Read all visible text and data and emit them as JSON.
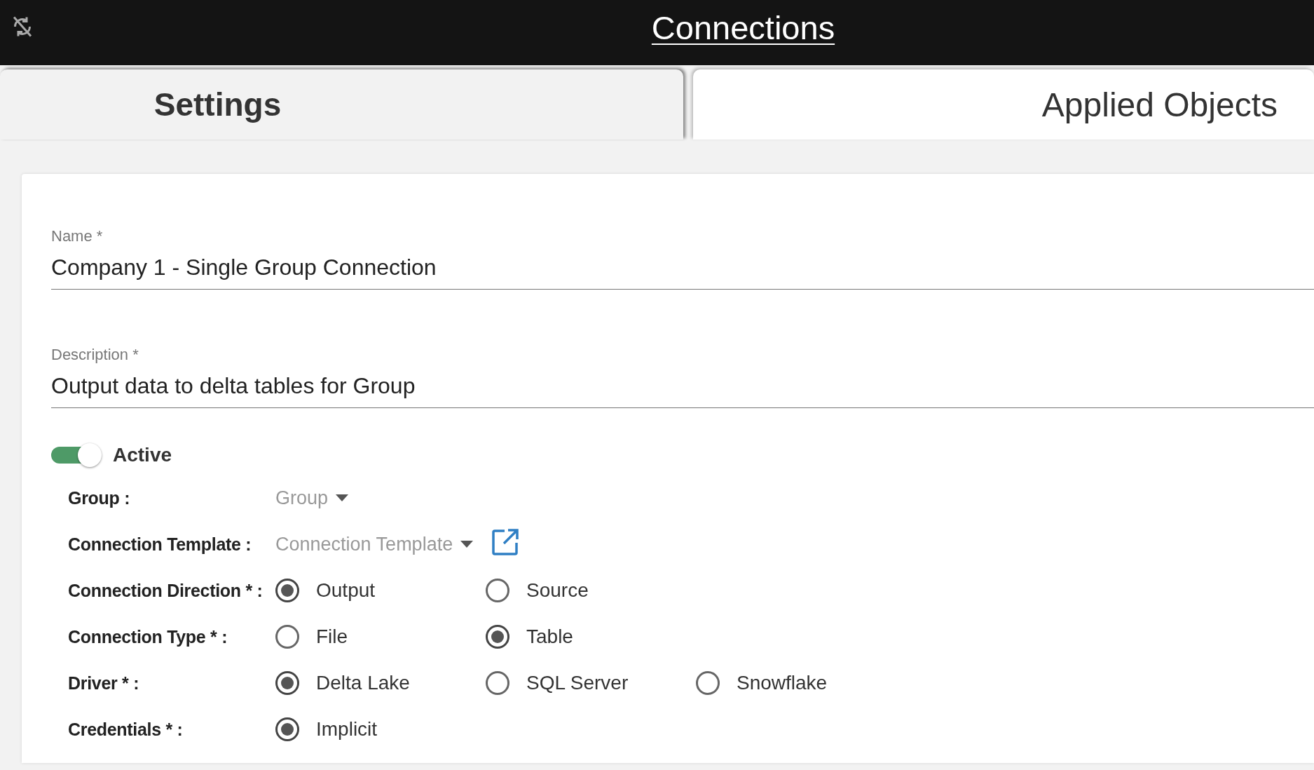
{
  "header": {
    "title": "Connections"
  },
  "tabs": [
    {
      "label": "Settings",
      "selected": true
    },
    {
      "label": "Applied Objects",
      "selected": false
    }
  ],
  "fields": [
    {
      "label": "Name *",
      "value": "Company 1 - Single Group Connection"
    },
    {
      "label": "Description *",
      "value": "Output data to delta tables for Group"
    }
  ],
  "active_toggle": {
    "label": "Active",
    "on": true
  },
  "rows": [
    {
      "kind": "select",
      "label": "Group :",
      "placeholder": "Group",
      "link": false
    },
    {
      "kind": "select",
      "label": "Connection Template :",
      "placeholder": "Connection Template",
      "link": true
    },
    {
      "kind": "radio",
      "label": "Connection Direction * :",
      "options": [
        {
          "label": "Output",
          "selected": true
        },
        {
          "label": "Source",
          "selected": false
        }
      ]
    },
    {
      "kind": "radio",
      "label": "Connection Type * :",
      "options": [
        {
          "label": "File",
          "selected": false
        },
        {
          "label": "Table",
          "selected": true
        }
      ]
    },
    {
      "kind": "radio",
      "label": "Driver * :",
      "options": [
        {
          "label": "Delta Lake",
          "selected": true
        },
        {
          "label": "SQL Server",
          "selected": false
        },
        {
          "label": "Snowflake",
          "selected": false
        }
      ]
    },
    {
      "kind": "radio",
      "label": "Credentials * :",
      "options": [
        {
          "label": "Implicit",
          "selected": true
        }
      ]
    }
  ]
}
